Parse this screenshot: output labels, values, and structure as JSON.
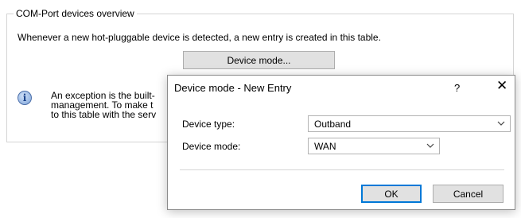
{
  "group": {
    "title": "COM-Port devices overview",
    "description": "Whenever a new hot-pluggable device is detected, a new entry is created in this table.",
    "device_mode_button": "Device mode...",
    "exception_lines": [
      "An exception is the built-",
      "management. To make t",
      "to this table with the serv"
    ]
  },
  "dialog": {
    "title": "Device mode - New Entry",
    "help_label": "?",
    "close_label": "✕",
    "device_type_label": "Device type:",
    "device_type_value": "Outband",
    "device_mode_label": "Device mode:",
    "device_mode_value": "WAN",
    "ok_label": "OK",
    "cancel_label": "Cancel"
  },
  "colors": {
    "dialog_border": "#8a8a8a",
    "ok_border": "#0078d7",
    "button_bg": "#e1e1e1"
  }
}
